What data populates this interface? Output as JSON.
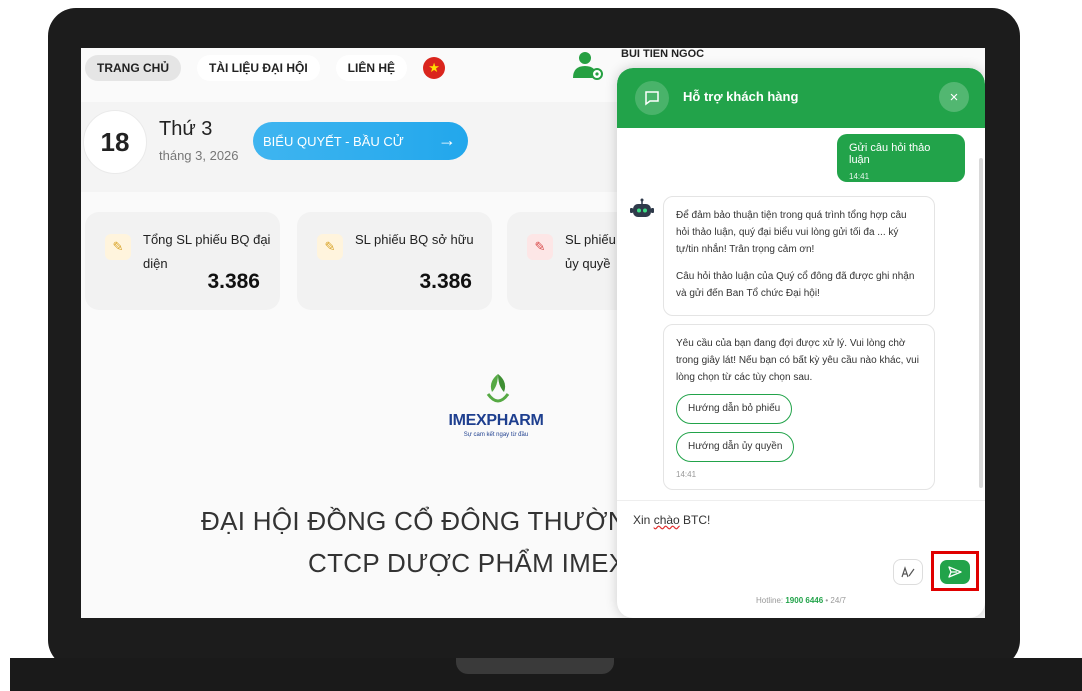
{
  "nav": {
    "items": [
      "TRANG CHỦ",
      "TÀI LIỆU ĐẠI HỘI",
      "LIÊN HỆ"
    ],
    "flag": "★",
    "user_name": "BUI TIEN NGOC"
  },
  "date": {
    "day": "18",
    "weekday": "Thứ 3",
    "month_year": "tháng 3, 2026"
  },
  "vote_button": {
    "label": "BIỂU QUYẾT - BẦU CỬ",
    "arrow": "→"
  },
  "stats": [
    {
      "label": "Tổng SL phiếu BQ đại diện",
      "value": "3.386"
    },
    {
      "label": "SL phiếu BQ sở hữu",
      "value": "3.386"
    },
    {
      "label": "SL phiếu ủy quyề"
    }
  ],
  "logo": {
    "word": "IMEXPHARM",
    "tagline": "Sự cam kết ngay từ đầu"
  },
  "headline": {
    "line1": "ĐẠI HỘI ĐỒNG CỔ ĐÔNG THƯỜNG N",
    "line2": "CTCP DƯỢC PHẨM IMEXP"
  },
  "chat": {
    "title": "Hỗ trợ khách hàng",
    "close": "×",
    "user_message": {
      "text": "Gửi câu hỏi thảo luận",
      "time": "14:41"
    },
    "bot_message_1": {
      "p1": "Để đảm bảo thuận tiện trong quá trình tổng hợp câu hỏi thảo luận, quý đại biểu vui lòng gửi tối đa ... ký tự/tin nhắn! Trân trọng cảm ơn!",
      "p2": "Câu hỏi thảo luận của Quý cổ đông đã được ghi nhận và gửi đến Ban Tổ chức Đại hội!"
    },
    "bot_message_2": {
      "text": "Yêu cầu của bạn đang đợi được xử lý. Vui lòng chờ trong giây lát! Nếu bạn có bất kỳ yêu cầu nào khác, vui lòng chọn từ các tùy chọn sau.",
      "options": [
        "Hướng dẫn bỏ phiếu",
        "Hướng dẫn ủy quyền"
      ],
      "time": "14:41"
    },
    "input": {
      "prefix": "Xin ",
      "misspelled": "chào",
      "suffix": " BTC!"
    },
    "hotline": {
      "label": "Hotline: ",
      "number": "1900 6446",
      "suffix": " • 24/7"
    }
  },
  "colors": {
    "brand_green": "#22a34a",
    "vote_blue": "#22a7ec",
    "highlight_red": "#e00000"
  }
}
